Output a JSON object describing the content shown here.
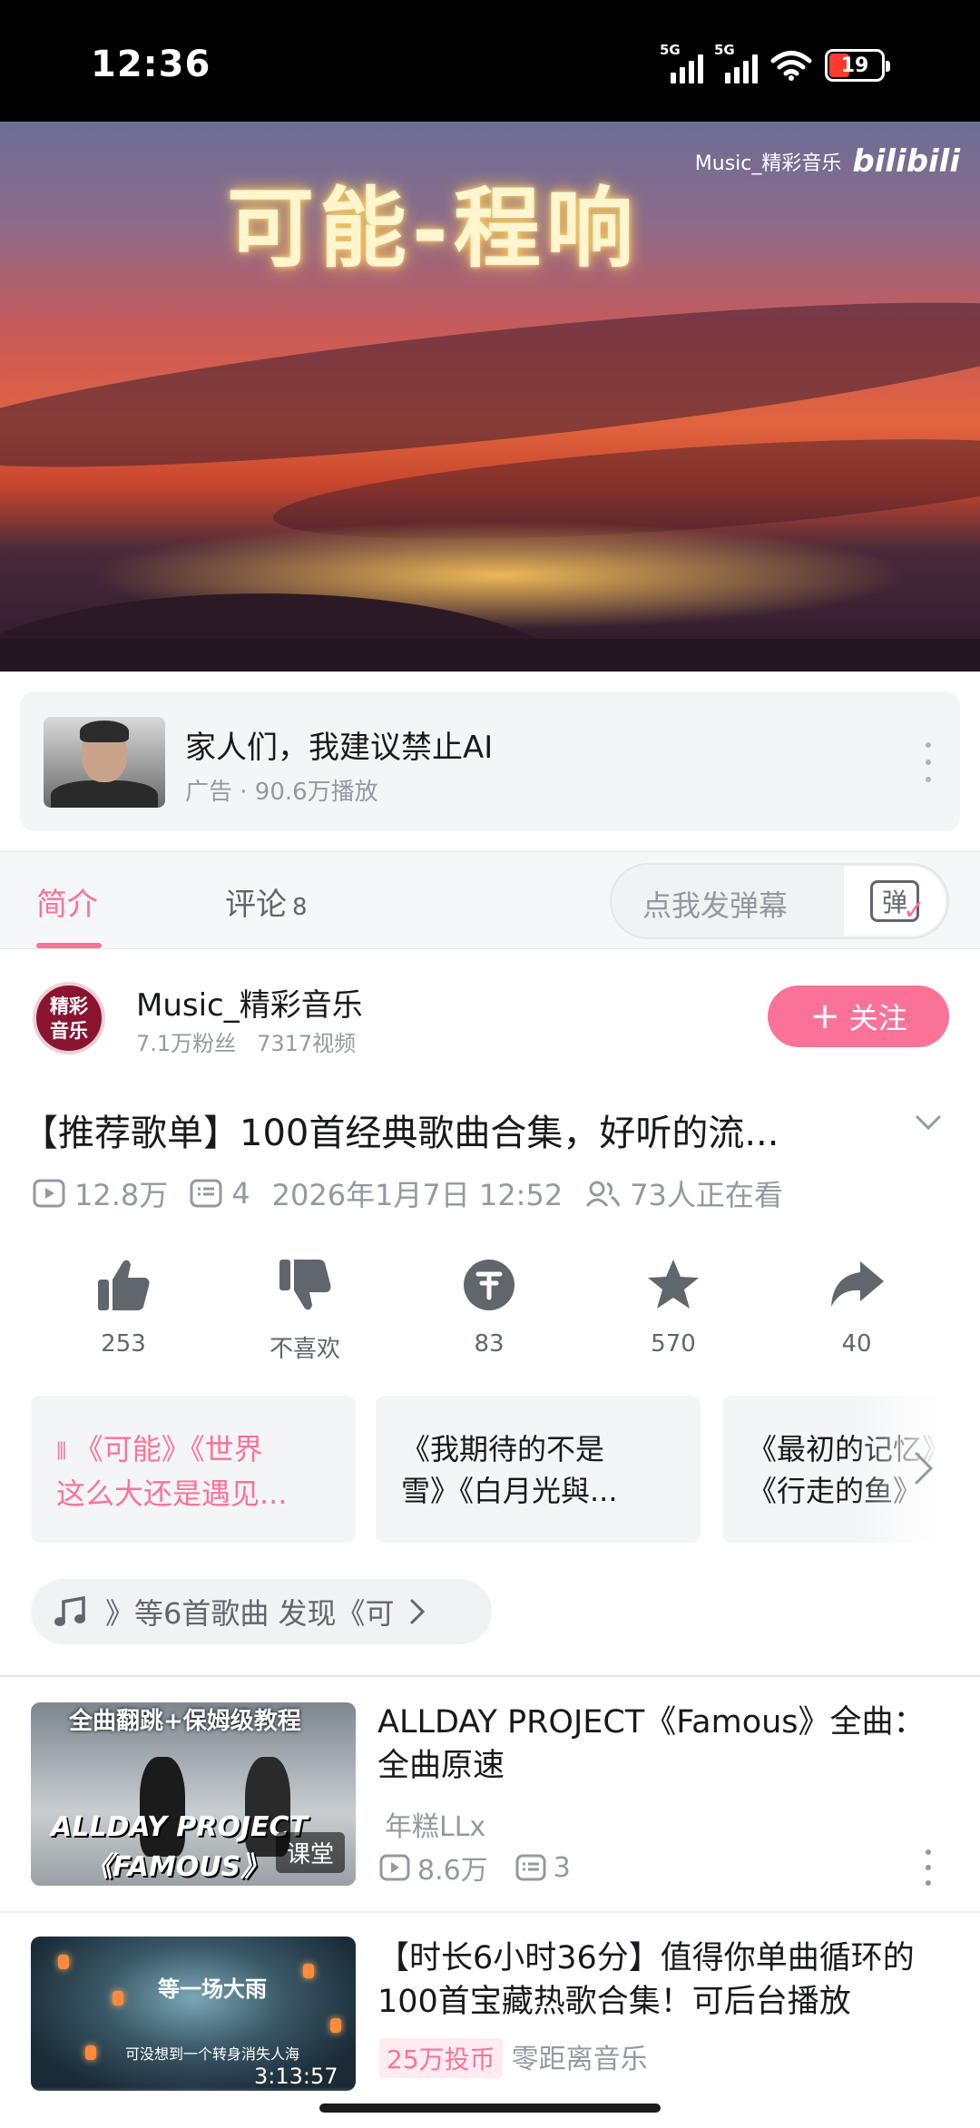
{
  "status_bar": {
    "time": "12:36",
    "network_1": "5G",
    "network_2": "5G",
    "battery": "19"
  },
  "video": {
    "overlay_title": "可能-程响",
    "watermark_channel": "Music_精彩音乐",
    "watermark_logo": "bilibili"
  },
  "ad": {
    "title": "家人们，我建议禁止AI",
    "meta": "广告 · 90.6万播放"
  },
  "tabs": {
    "intro": "简介",
    "comments": "评论",
    "comments_count": "8",
    "danmaku_placeholder": "点我发弹幕",
    "danmaku_icon_char": "弹"
  },
  "uploader": {
    "avatar_text_1": "精彩",
    "avatar_text_2": "音乐",
    "name": "Music_精彩音乐",
    "fans": "7.1万粉丝",
    "videos": "7317视频",
    "follow_label": "关注"
  },
  "video_info": {
    "title": "【推荐歌单】100首经典歌曲合集，好听的流...",
    "plays": "12.8万",
    "danmaku_count": "4",
    "date": "2026年1月7日 12:52",
    "watching": "73人正在看"
  },
  "actions": {
    "like": "253",
    "dislike": "不喜欢",
    "coin": "83",
    "favorite": "570",
    "share": "40"
  },
  "song_chips": [
    {
      "line1": "《可能》《世界",
      "line2": "这么大还是遇见..."
    },
    {
      "line1": "《我期待的不是",
      "line2": "雪》《白月光與..."
    },
    {
      "line1": "《最初的记忆》",
      "line2": "《行走的鱼》"
    }
  ],
  "music_pill": {
    "text": "》等6首歌曲   发现《可"
  },
  "recommendations": [
    {
      "thumb_top": "全曲翻跳+保姆级教程",
      "thumb_mid": "ALLDAY PROJECT",
      "thumb_bottom": "《FAMOUS》",
      "badge": "课堂",
      "title": "ALLDAY PROJECT《Famous》全曲：全曲原速",
      "author": "年糕LLx",
      "plays": "8.6万",
      "danmaku": "3"
    },
    {
      "thumb_top": "等一场大雨",
      "thumb_mid": "可没想到一个转身消失人海",
      "duration": "3:13:57",
      "title": "【时长6小时36分】值得你单曲循环的100首宝藏热歌合集！可后台播放",
      "coin_tag": "25万投币",
      "author": "零距离音乐"
    }
  ],
  "colors": {
    "accent": "#fb7299",
    "text_primary": "#18191c",
    "text_secondary": "#9499a0"
  }
}
